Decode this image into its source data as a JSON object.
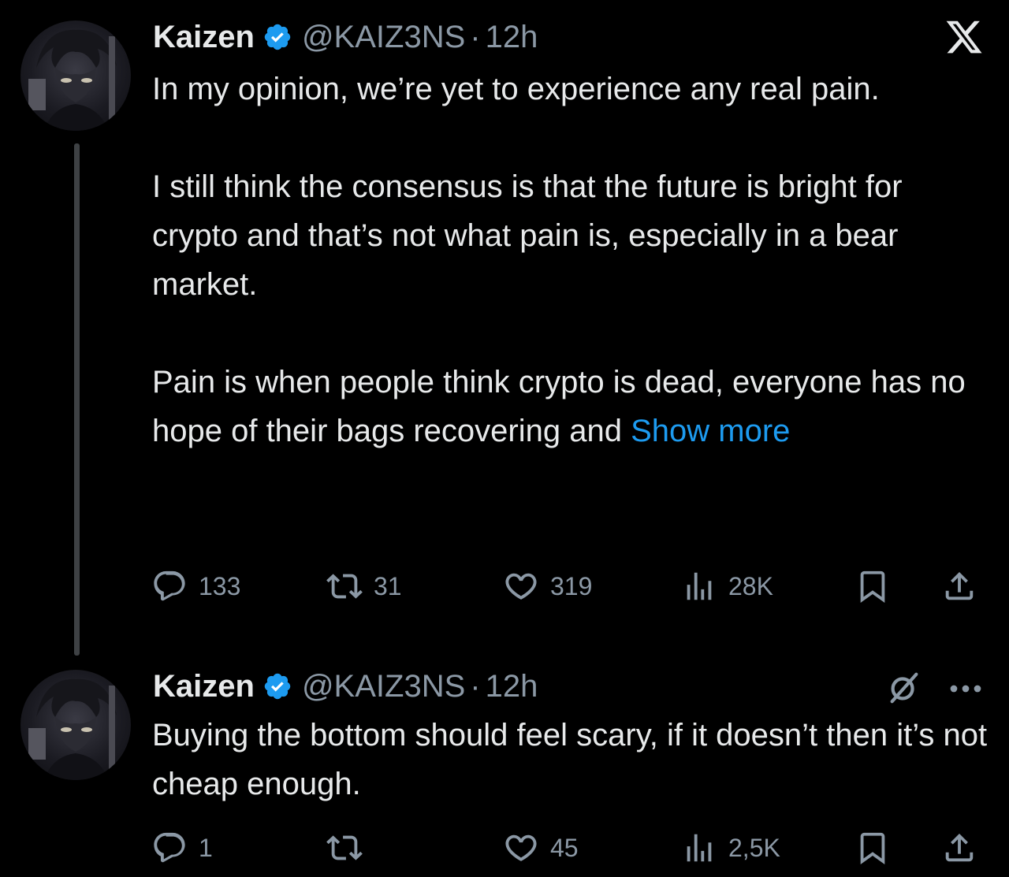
{
  "colors": {
    "background": "#000000",
    "text": "#e7e9ea",
    "secondary": "#8b98a5",
    "link": "#1d9bf0",
    "verified": "#1d9bf0",
    "thread_line": "#3e4144"
  },
  "app_icon": "x-logo-icon",
  "tweets": [
    {
      "display_name": "Kaizen",
      "handle": "@KAIZ3NS",
      "separator": "·",
      "time": "12h",
      "paragraphs": [
        "In my opinion, we’re yet to experience any real pain.",
        "I still think the consensus is that the future is bright for crypto and that’s not what pain is, especially in a bear market.",
        "Pain is when people think crypto is dead, everyone has no hope of their bags recovering and"
      ],
      "show_more": "Show more",
      "replies": "133",
      "retweets": "31",
      "likes": "319",
      "views": "28K"
    },
    {
      "display_name": "Kaizen",
      "handle": "@KAIZ3NS",
      "separator": "·",
      "time": "12h",
      "paragraphs": [
        "Buying the bottom should feel scary, if it doesn’t then it’s not cheap enough."
      ],
      "replies": "1",
      "retweets": "",
      "likes": "45",
      "views": "2,5K"
    }
  ]
}
